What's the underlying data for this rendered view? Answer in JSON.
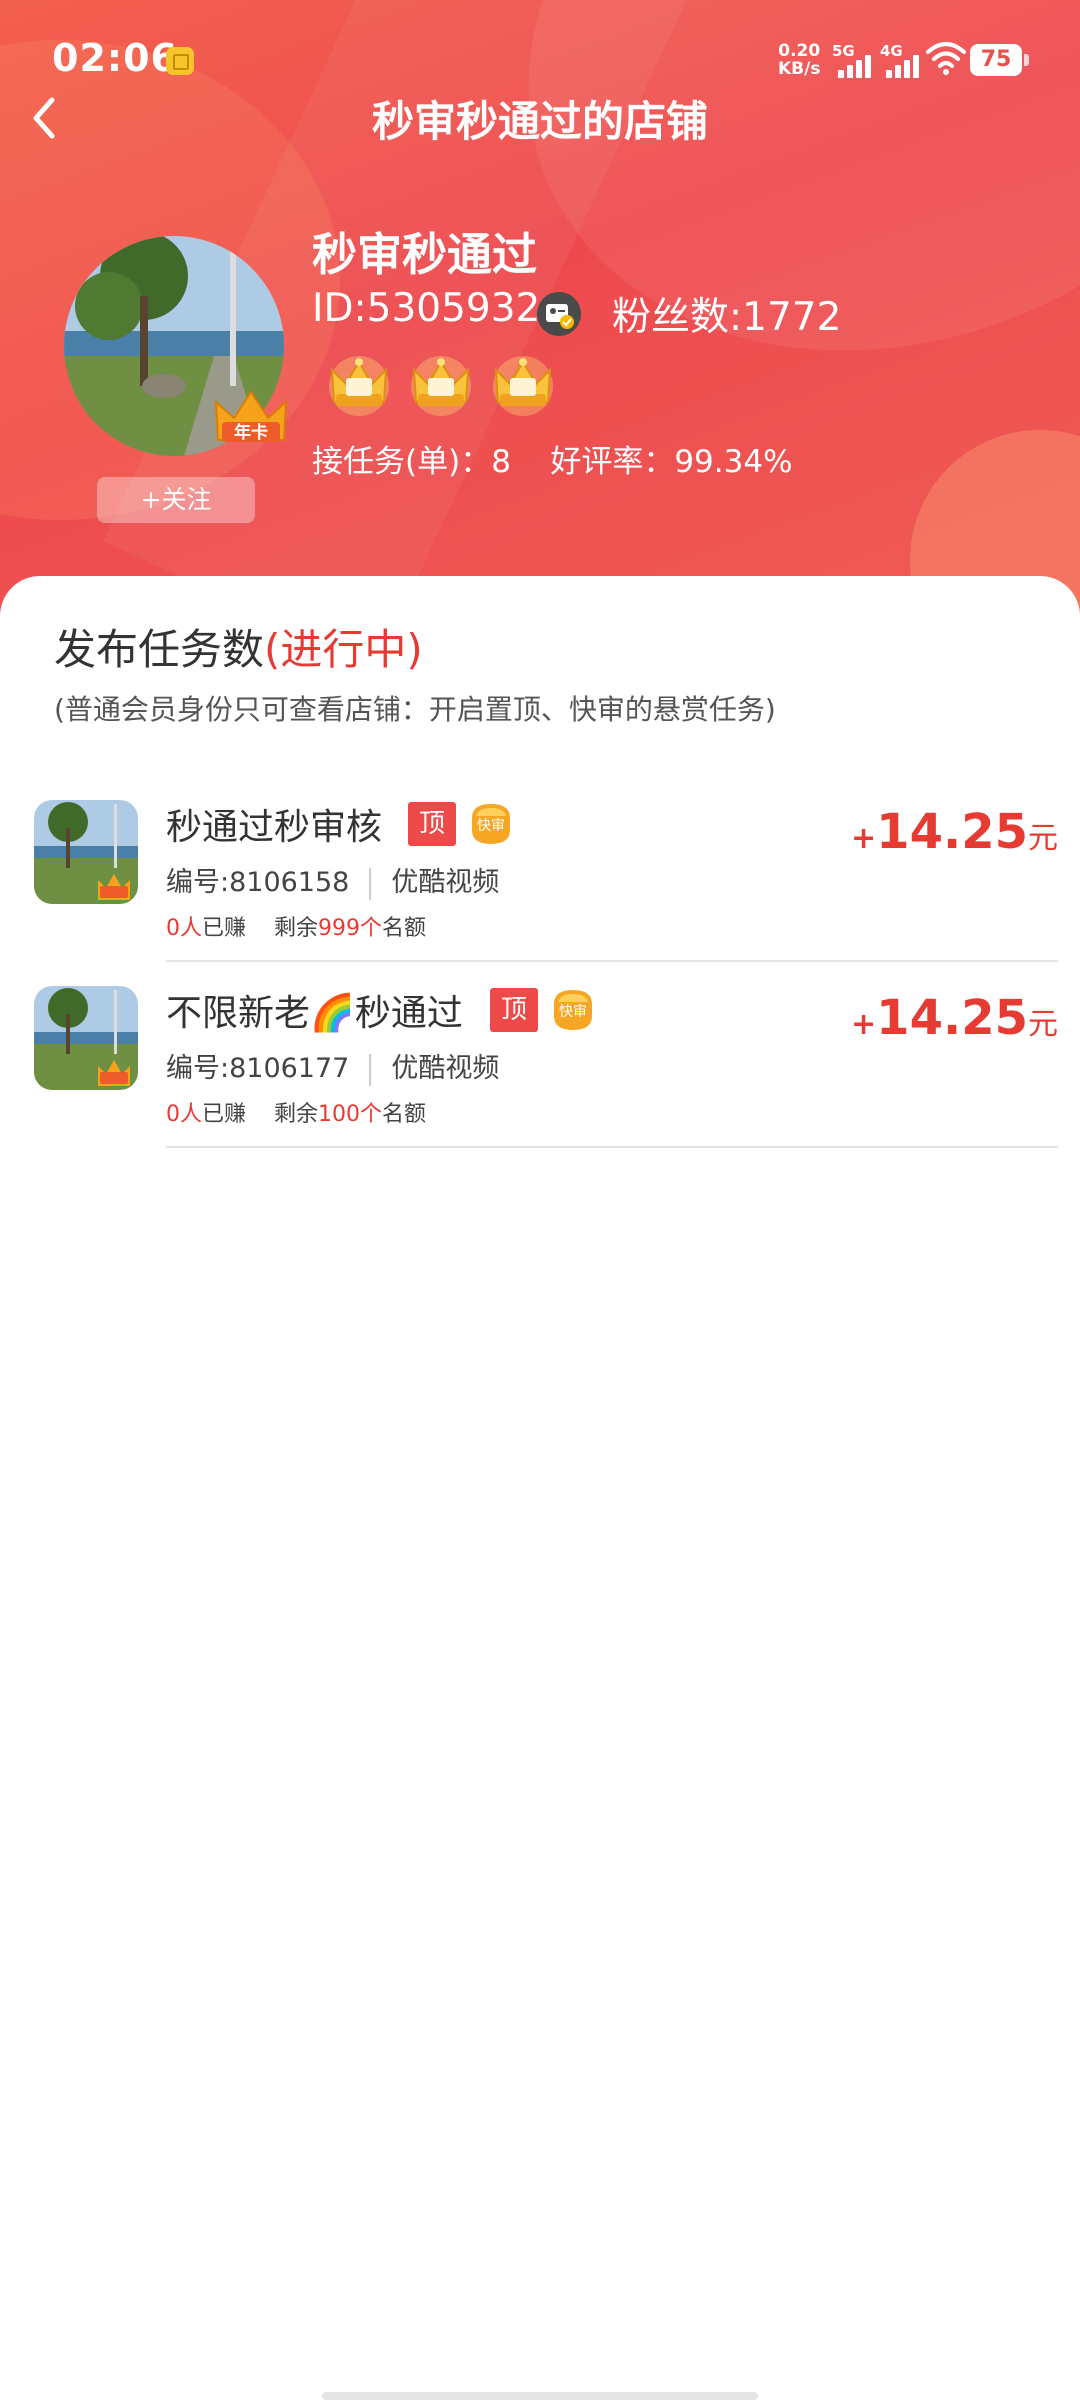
{
  "status_bar": {
    "time": "02:06",
    "net_speed_value": "0.20",
    "net_speed_unit": "KB/s",
    "signal_1": "5G",
    "signal_2": "4G",
    "battery": "75"
  },
  "header": {
    "title": "秒审秒通过的店铺"
  },
  "shop": {
    "name": "秒审秒通过",
    "id": "ID:5305932",
    "fans": "粉丝数:1772",
    "follow_label": "+关注",
    "avatar_badge": "年卡",
    "crown_count": 3,
    "stats": "接任务(单)：8    好评率：99.34%"
  },
  "section": {
    "title": "发布任务数",
    "title_status": "(进行中)",
    "subtitle": "(普通会员身份只可查看店铺：开启置顶、快审的悬赏任务)"
  },
  "tasks": [
    {
      "name": "秒通过秒审核",
      "badge_top": "顶",
      "badge_fast": "快审",
      "number": "编号:8106158",
      "platform": "优酷视频",
      "earned_count": "0人",
      "earned_label": "已赚",
      "remaining_label": "剩余",
      "remaining_count": "999个",
      "quota_label": "名额",
      "reward_plus": "+",
      "reward": "14.25",
      "reward_unit": "元"
    },
    {
      "name": "不限新老🌈秒通过",
      "badge_top": "顶",
      "badge_fast": "快审",
      "number": "编号:8106177",
      "platform": "优酷视频",
      "earned_count": "0人",
      "earned_label": "已赚",
      "remaining_label": "剩余",
      "remaining_count": "100个",
      "quota_label": "名额",
      "reward_plus": "+",
      "reward": "14.25",
      "reward_unit": "元"
    }
  ],
  "colors": {
    "header": "#ee4a4e",
    "accent_red": "#e63b32",
    "badge_top": "#ef4a4a",
    "badge_fast": "#f5a623"
  },
  "icons": {
    "back": "back-arrow-icon",
    "id_card": "id-card-verified-icon",
    "crown": "gold-crown-icon",
    "fast_review": "fast-review-badge-icon",
    "wifi": "wifi-icon",
    "signal": "signal-bars-icon"
  }
}
